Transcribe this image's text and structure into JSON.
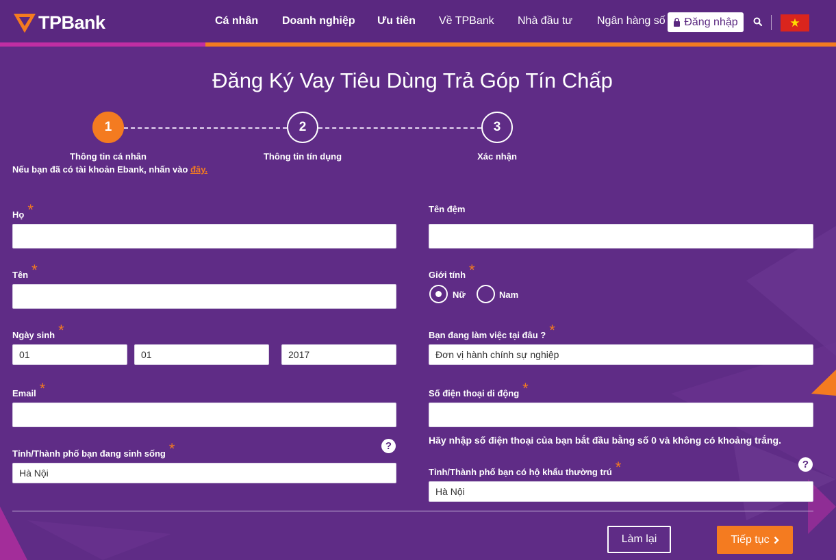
{
  "brand": {
    "name": "TPBank",
    "accent": "#f47b20",
    "primary": "#5f2c86"
  },
  "nav": {
    "items": [
      {
        "label": "Cá nhân",
        "bold": true
      },
      {
        "label": "Doanh nghiệp",
        "bold": true
      },
      {
        "label": "Ưu tiên",
        "bold": true
      },
      {
        "label": "Về TPBank",
        "bold": false
      },
      {
        "label": "Nhà đầu tư",
        "bold": false
      },
      {
        "label": "Ngân hàng số",
        "bold": false
      }
    ],
    "login_label": "Đăng nhập",
    "login_icon": "lock-icon",
    "search_icon": "search-icon",
    "flag_icon": "vietnam-flag-icon"
  },
  "page": {
    "title": "Đăng Ký Vay Tiêu Dùng Trả Góp Tín Chấp"
  },
  "steps": [
    {
      "number": "1",
      "label": "Thông tin cá nhân",
      "active": true
    },
    {
      "number": "2",
      "label": "Thông tin tín dụng",
      "active": false
    },
    {
      "number": "3",
      "label": "Xác nhận",
      "active": false
    }
  ],
  "ebank_note": {
    "text": "Nếu bạn đã có tài khoản Ebank, nhấn vào ",
    "link": "đây."
  },
  "form": {
    "ho": {
      "label": "Họ",
      "value": ""
    },
    "ten_dem": {
      "label": "Tên đệm",
      "value": ""
    },
    "ten": {
      "label": "Tên",
      "value": ""
    },
    "gioi_tinh": {
      "label": "Giới tính",
      "options": [
        "Nữ",
        "Nam"
      ],
      "selected": "Nữ"
    },
    "ngay_sinh": {
      "label": "Ngày sinh",
      "day": "01",
      "month": "01",
      "year": "2017"
    },
    "noi_lam_viec": {
      "label": "Bạn đang làm việc tại đâu ?",
      "value": "Đơn vị hành chính sự nghiệp"
    },
    "email": {
      "label": "Email",
      "value": ""
    },
    "so_dien_thoai": {
      "label": "Số điện thoại di động",
      "value": "",
      "hint": "Hãy nhập số điện thoại của bạn bắt đầu bằng số 0 và không có khoảng trắng."
    },
    "tinh_sinh_song": {
      "label": "Tỉnh/Thành phố bạn đang sinh sống",
      "value": "Hà Nội"
    },
    "tinh_thuong_tru": {
      "label": "Tỉnh/Thành phố bạn có hộ khẩu thường trú",
      "value": "Hà Nội"
    },
    "required_mark": "*",
    "help_mark": "?"
  },
  "buttons": {
    "reset": "Làm lại",
    "next": "Tiếp tục"
  }
}
